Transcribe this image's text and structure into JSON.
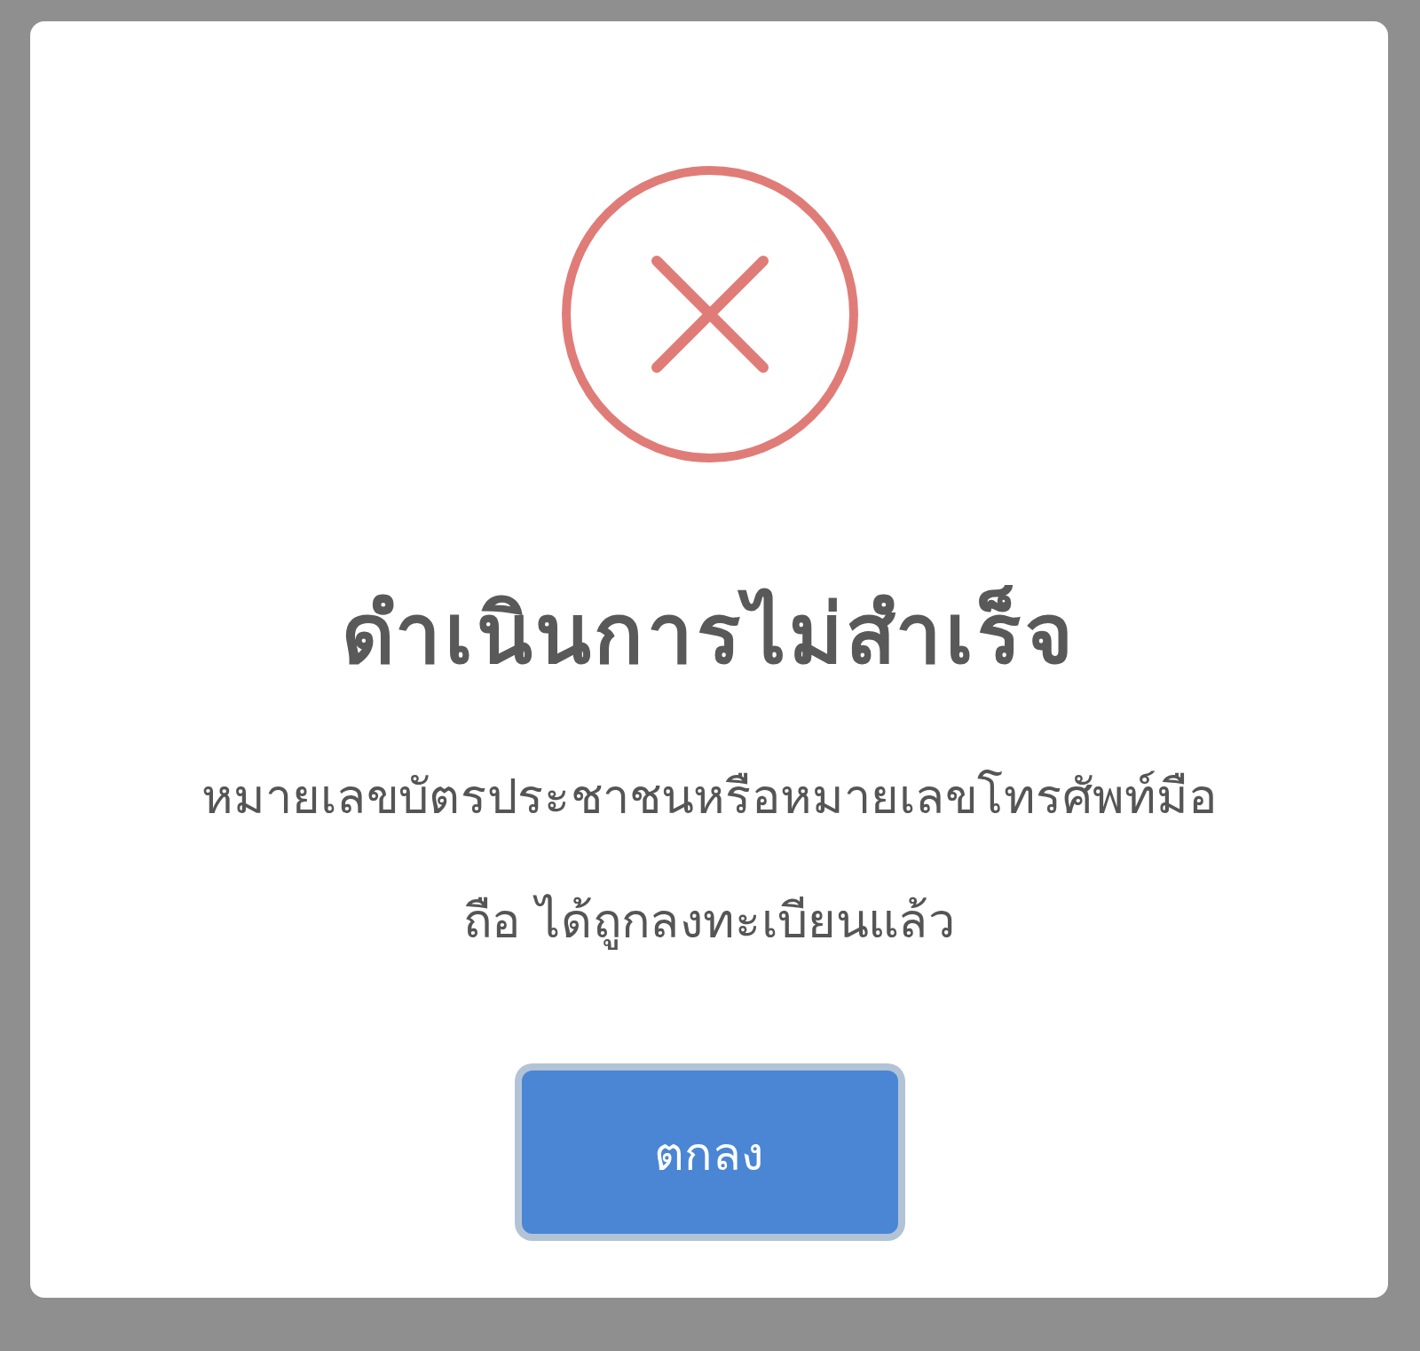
{
  "dialog": {
    "title": "ดำเนินการไม่สำเร็จ",
    "message": "หมายเลขบัตรประชาชนหรือหมายเลขโทรศัพท์มือถือ ได้ถูกลงทะเบียนแล้ว",
    "buttons": [
      {
        "label": "ตกลง",
        "focused": true
      }
    ]
  }
}
